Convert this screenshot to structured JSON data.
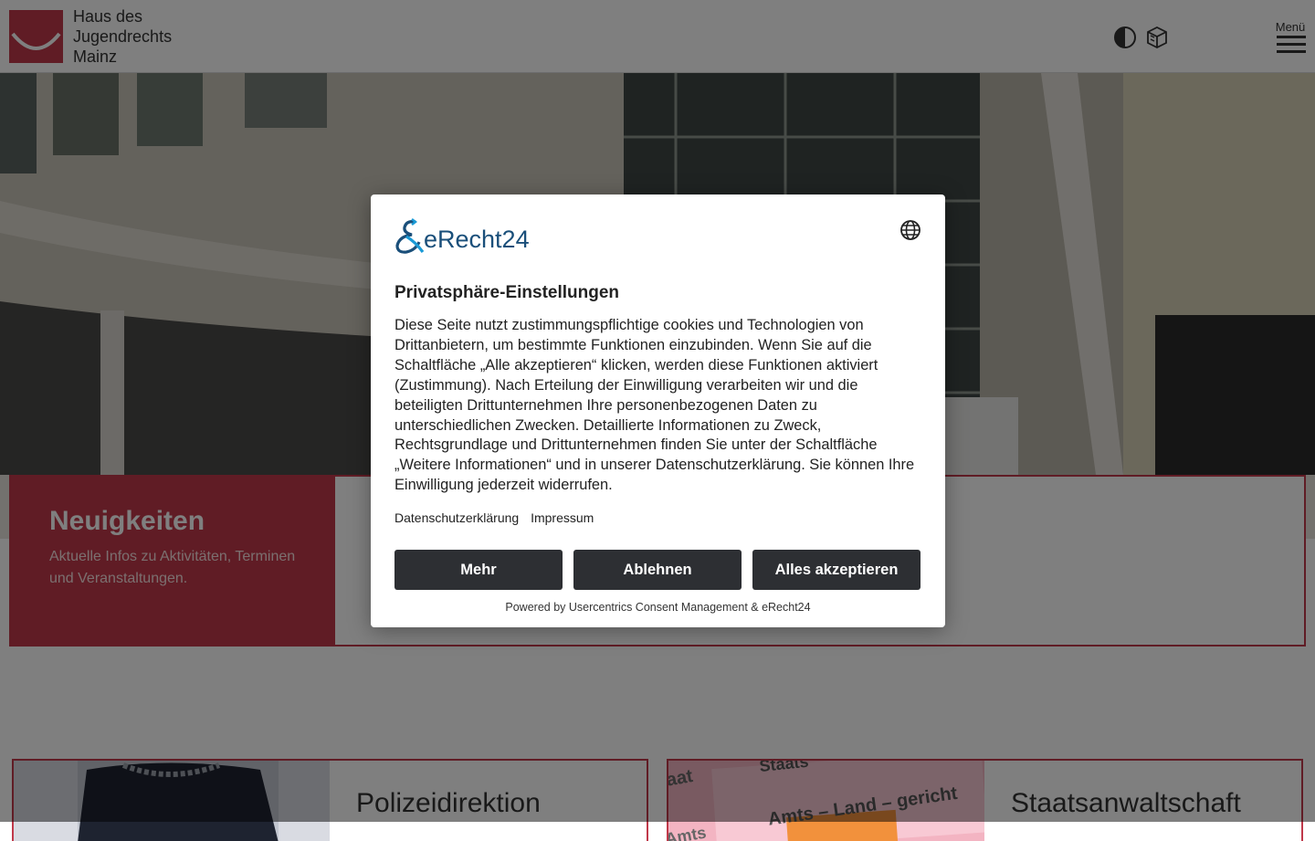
{
  "header": {
    "logo_lines": [
      "Haus des",
      "Jugendrechts",
      "Mainz"
    ],
    "contrast_icon": "contrast-icon",
    "accessibility_icon": "accessibility-icon",
    "menu_label": "Menü",
    "menu_icon": "hamburger-icon"
  },
  "news": {
    "title": "Neuigkeiten",
    "subtitle": "Aktuelle Infos zu Aktivitäten, Terminen und Veranstaltungen."
  },
  "cards": [
    {
      "title": "Polizeidirektion"
    },
    {
      "title": "Staatsanwaltschaft",
      "image_text": [
        "Staats",
        "Amts – Land – gericht",
        "aat",
        "Amts"
      ]
    }
  ],
  "consent": {
    "brand": "eRecht24",
    "language_icon": "globe-icon",
    "title": "Privatsphäre-Einstellungen",
    "body": "Diese Seite nutzt zustimmungspflichtige cookies und Technologien von Drittanbietern, um bestimmte Funktionen einzubinden. Wenn Sie auf die Schaltfläche „Alle akzeptieren“ klicken, werden diese Funktionen aktiviert (Zustimmung). Nach Erteilung der Einwilligung verarbeiten wir und die beteiligten Drittunternehmen Ihre personenbezogenen Daten zu unterschiedlichen Zwecken. Detaillierte Informationen zu Zweck, Rechtsgrundlage und Drittunternehmen finden Sie unter der Schaltfläche „Weitere Informationen“ und in unserer Datenschutzerklärung. Sie können Ihre Einwilligung jederzeit widerrufen.",
    "links": [
      "Datenschutzerklärung",
      "Impressum"
    ],
    "buttons": {
      "more": "Mehr",
      "reject": "Ablehnen",
      "accept": "Alles akzeptieren"
    },
    "powered_by": "Powered by Usercentrics Consent Management & eRecht24"
  },
  "colors": {
    "brand_red": "#c0394a",
    "button_dark": "#2d2f33",
    "erecht_blue": "#1a4f7a"
  }
}
